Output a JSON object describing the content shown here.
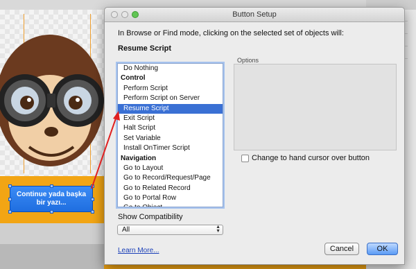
{
  "background_app": {
    "button_text": "Continue yada başka bir yazı..."
  },
  "dialog": {
    "title": "Button Setup",
    "intro": "In Browse or Find mode, clicking on the selected set of objects will:",
    "selected_action": "Resume Script",
    "actions": [
      {
        "label": "Do Nothing",
        "type": "item"
      },
      {
        "label": "Control",
        "type": "header"
      },
      {
        "label": "Perform Script",
        "type": "item"
      },
      {
        "label": "Perform Script on Server",
        "type": "item"
      },
      {
        "label": "Resume Script",
        "type": "item",
        "selected": true
      },
      {
        "label": "Exit Script",
        "type": "item"
      },
      {
        "label": "Halt Script",
        "type": "item"
      },
      {
        "label": "Set Variable",
        "type": "item"
      },
      {
        "label": "Install OnTimer Script",
        "type": "item"
      },
      {
        "label": "Navigation",
        "type": "header"
      },
      {
        "label": "Go to Layout",
        "type": "item"
      },
      {
        "label": "Go to Record/Request/Page",
        "type": "item"
      },
      {
        "label": "Go to Related Record",
        "type": "item"
      },
      {
        "label": "Go to Portal Row",
        "type": "item"
      },
      {
        "label": "Go to Object",
        "type": "item"
      }
    ],
    "options_label": "Options",
    "hand_cursor_label": "Change to hand cursor over button",
    "hand_cursor_checked": false,
    "compat_label": "Show Compatibility",
    "compat_value": "All",
    "learn_more": "Learn More...",
    "cancel": "Cancel",
    "ok": "OK"
  },
  "colors": {
    "selection": "#3a70d4",
    "default_button": "#5a9bf5",
    "annotation_arrow": "#e02020",
    "canvas_bg": "#f2a514"
  }
}
